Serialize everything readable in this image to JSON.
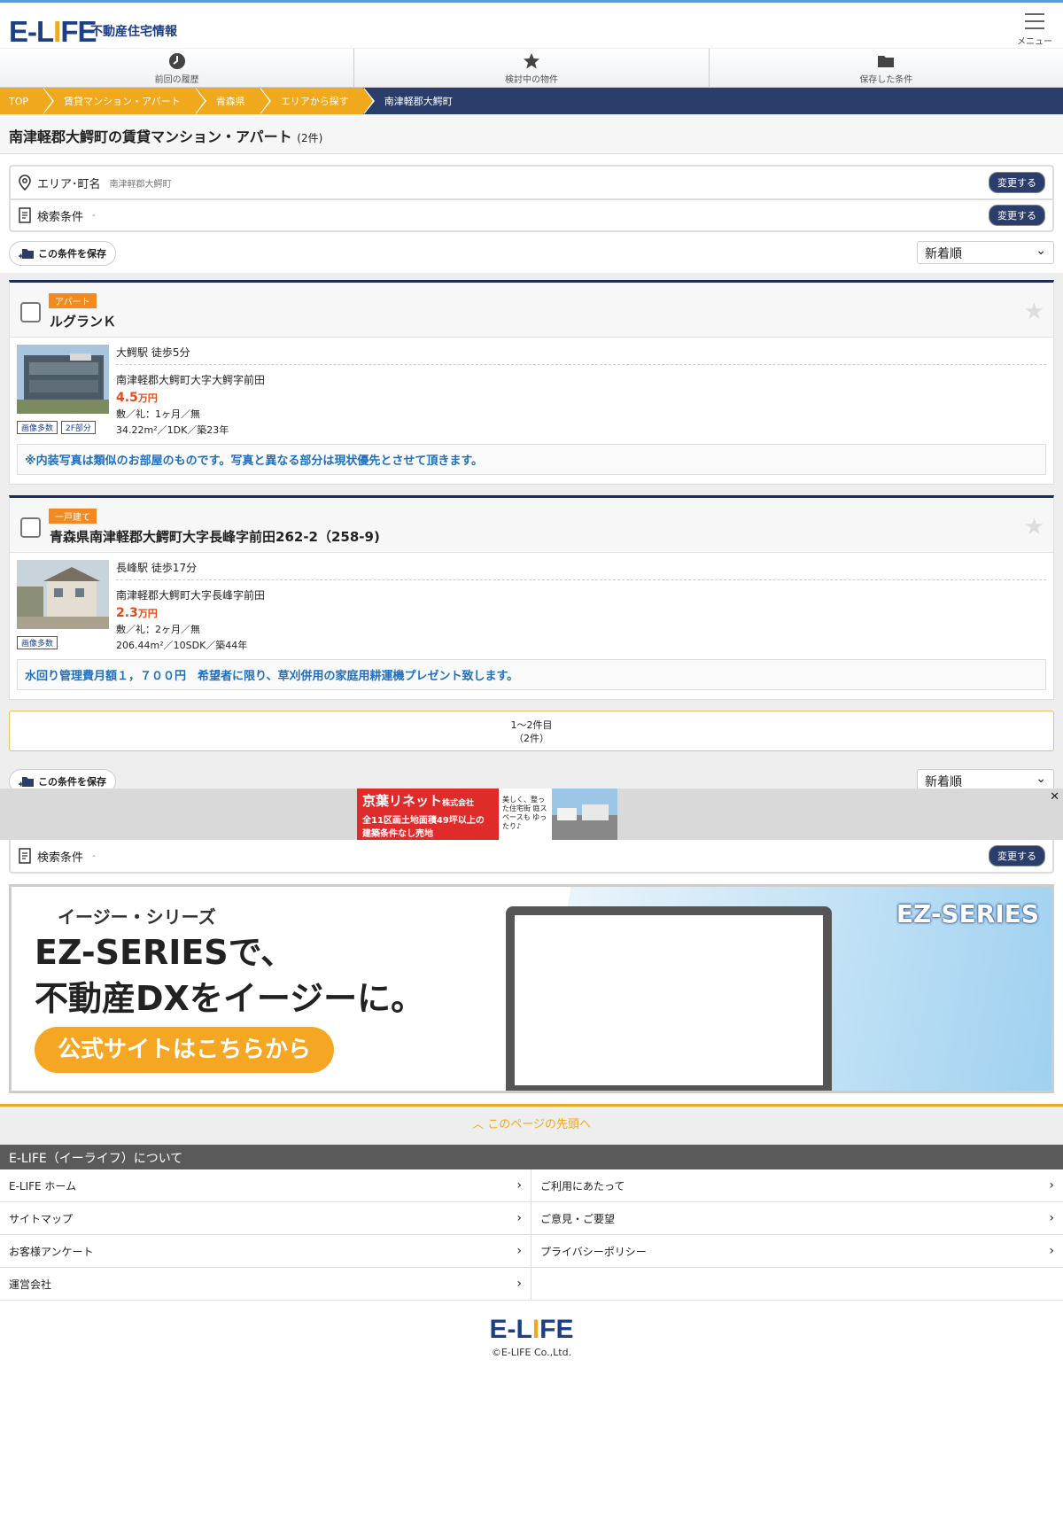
{
  "header": {
    "logo_prefix": "E-L",
    "logo_i": "I",
    "logo_suffix": "FE",
    "tagline": "不動産住宅情報",
    "menu_label": "メニュー"
  },
  "nav_tabs": [
    {
      "label": "前回の履歴",
      "icon": "clock-icon"
    },
    {
      "label": "検討中の物件",
      "icon": "star-icon"
    },
    {
      "label": "保存した条件",
      "icon": "folder-icon"
    }
  ],
  "breadcrumb": [
    "TOP",
    "賃貸マンション・アパート",
    "青森県",
    "エリアから探す",
    "南津軽郡大鰐町"
  ],
  "page_title": {
    "title": "南津軽郡大鰐町の賃貸マンション・アパート",
    "count": "(2件)"
  },
  "conditions": {
    "area_label": "エリア･町名",
    "area_value": "南津軽郡大鰐町",
    "search_label": "検索条件",
    "search_value": "-",
    "change_label": "変更する"
  },
  "save_label": "この条件を保存",
  "sort": {
    "selected": "新着順"
  },
  "listings": [
    {
      "tag": "アパート",
      "name": "ルグランＫ",
      "access": "大鰐駅 徒歩5分",
      "address": "南津軽郡大鰐町大字大鰐字前田",
      "price": "4.5",
      "price_unit": "万円",
      "deposit": "敷／礼：1ヶ月／無",
      "spec": "34.22m²／1DK／築23年",
      "photo_tags": [
        "画像多数",
        "2F部分"
      ],
      "note": "※内装写真は類似のお部屋のものです。写真と異なる部分は現状優先とさせて頂きます。"
    },
    {
      "tag": "一戸建て",
      "name": "青森県南津軽郡大鰐町大字長峰字前田262-2（258-9)",
      "access": "長峰駅 徒歩17分",
      "address": "南津軽郡大鰐町大字長峰字前田",
      "price": "2.3",
      "price_unit": "万円",
      "deposit": "敷／礼：2ヶ月／無",
      "spec": "206.44m²／10SDK／築44年",
      "photo_tags": [
        "画像多数"
      ],
      "note": "水回り管理費月額１，７００円　希望者に限り、草刈併用の家庭用耕運機プレゼント致します。"
    }
  ],
  "pager": {
    "range": "1〜2件目",
    "total": "（2件）"
  },
  "ad": {
    "line1": "京葉リネット",
    "line1b": "株式会社",
    "line2": "全11区画土地面積49坪以上の",
    "line3": "建築条件なし売地",
    "mid": "美しく、整った住宅街 庭スペースも ゆったり♪",
    "close": "✕"
  },
  "banner": {
    "small": "イージー・シリーズ",
    "big1": "EZ-SERIESで、",
    "big2": "不動産DXをイージーに。",
    "button": "公式サイトはこちらから",
    "logo": "EZ-SERIES"
  },
  "to_top": "このページの先頭へ",
  "about_title": "E-LIFE（イーライフ）について",
  "footer_links": [
    "E-LIFE ホーム",
    "ご利用にあたって",
    "サイトマップ",
    "ご意見・ご要望",
    "お客様アンケート",
    "プライバシーポリシー",
    "運営会社",
    ""
  ],
  "copyright": "©E-LIFE Co.,Ltd."
}
